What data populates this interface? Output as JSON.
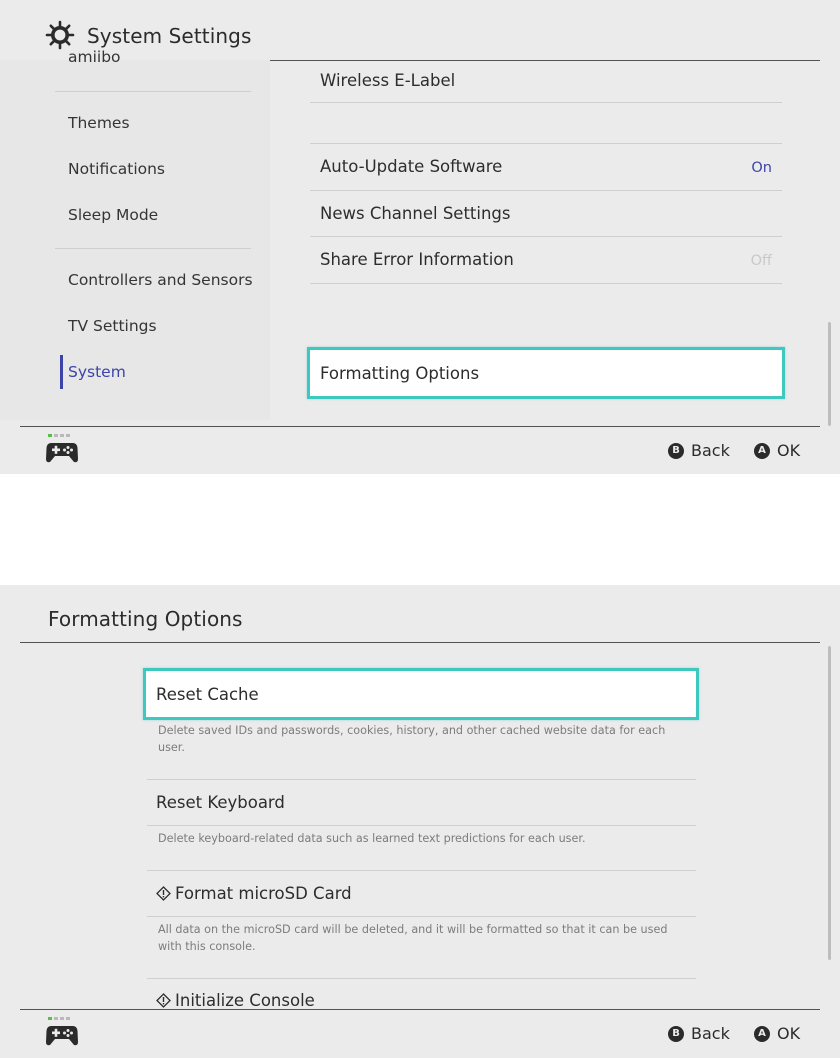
{
  "screen1": {
    "header": {
      "title": "System Settings",
      "icon": "gear-icon"
    },
    "sidebar": {
      "clipped_item": "amiibo",
      "items": [
        {
          "label": "Themes"
        },
        {
          "label": "Notifications"
        },
        {
          "label": "Sleep Mode"
        },
        {
          "label": "Controllers and Sensors"
        },
        {
          "label": "TV Settings"
        },
        {
          "label": "System",
          "active": true
        }
      ]
    },
    "list": {
      "items": [
        {
          "label": "Wireless E-Label",
          "value": ""
        },
        {
          "label": "Auto-Update Software",
          "value": "On"
        },
        {
          "label": "News Channel Settings",
          "value": ""
        },
        {
          "label": "Share Error Information",
          "value": "Off"
        },
        {
          "label": "Formatting Options",
          "value": "",
          "focused": true
        }
      ]
    },
    "footer": {
      "back_button": "B",
      "back_label": "Back",
      "ok_button": "A",
      "ok_label": "OK"
    }
  },
  "screen2": {
    "header": {
      "title": "Formatting Options"
    },
    "options": [
      {
        "title": "Reset Cache",
        "description": "Delete saved IDs and passwords, cookies, history, and other cached website data for each user.",
        "focused": true
      },
      {
        "title": "Reset Keyboard",
        "description": "Delete keyboard-related data such as learned text predictions for each user."
      },
      {
        "title": "Format microSD Card",
        "warning": true,
        "description": "All data on the microSD card will be deleted, and it will be formatted so that it can be used with this console."
      },
      {
        "title": "Initialize Console",
        "warning": true
      }
    ],
    "footer": {
      "back_button": "B",
      "back_label": "Back",
      "ok_button": "A",
      "ok_label": "OK"
    }
  },
  "colors": {
    "accent": "#3c44a8",
    "focus": "#3ec8c0",
    "background": "#ebebeb",
    "controller_led": "#58c048"
  }
}
